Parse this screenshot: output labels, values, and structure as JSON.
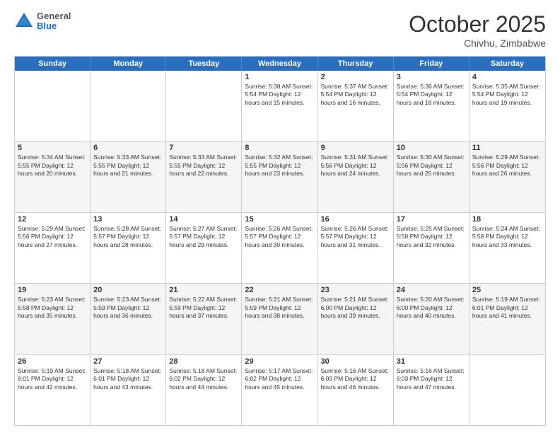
{
  "header": {
    "logo_general": "General",
    "logo_blue": "Blue",
    "month_title": "October 2025",
    "location": "Chivhu, Zimbabwe"
  },
  "days_of_week": [
    "Sunday",
    "Monday",
    "Tuesday",
    "Wednesday",
    "Thursday",
    "Friday",
    "Saturday"
  ],
  "rows": [
    {
      "cells": [
        {
          "day": "",
          "info": ""
        },
        {
          "day": "",
          "info": ""
        },
        {
          "day": "",
          "info": ""
        },
        {
          "day": "1",
          "info": "Sunrise: 5:38 AM\nSunset: 5:54 PM\nDaylight: 12 hours\nand 15 minutes."
        },
        {
          "day": "2",
          "info": "Sunrise: 5:37 AM\nSunset: 5:54 PM\nDaylight: 12 hours\nand 16 minutes."
        },
        {
          "day": "3",
          "info": "Sunrise: 5:36 AM\nSunset: 5:54 PM\nDaylight: 12 hours\nand 18 minutes."
        },
        {
          "day": "4",
          "info": "Sunrise: 5:35 AM\nSunset: 5:54 PM\nDaylight: 12 hours\nand 19 minutes."
        }
      ],
      "alt": false
    },
    {
      "cells": [
        {
          "day": "5",
          "info": "Sunrise: 5:34 AM\nSunset: 5:55 PM\nDaylight: 12 hours\nand 20 minutes."
        },
        {
          "day": "6",
          "info": "Sunrise: 5:33 AM\nSunset: 5:55 PM\nDaylight: 12 hours\nand 21 minutes."
        },
        {
          "day": "7",
          "info": "Sunrise: 5:33 AM\nSunset: 5:55 PM\nDaylight: 12 hours\nand 22 minutes."
        },
        {
          "day": "8",
          "info": "Sunrise: 5:32 AM\nSunset: 5:55 PM\nDaylight: 12 hours\nand 23 minutes."
        },
        {
          "day": "9",
          "info": "Sunrise: 5:31 AM\nSunset: 5:56 PM\nDaylight: 12 hours\nand 24 minutes."
        },
        {
          "day": "10",
          "info": "Sunrise: 5:30 AM\nSunset: 5:56 PM\nDaylight: 12 hours\nand 25 minutes."
        },
        {
          "day": "11",
          "info": "Sunrise: 5:29 AM\nSunset: 5:56 PM\nDaylight: 12 hours\nand 26 minutes."
        }
      ],
      "alt": true
    },
    {
      "cells": [
        {
          "day": "12",
          "info": "Sunrise: 5:29 AM\nSunset: 5:56 PM\nDaylight: 12 hours\nand 27 minutes."
        },
        {
          "day": "13",
          "info": "Sunrise: 5:28 AM\nSunset: 5:57 PM\nDaylight: 12 hours\nand 28 minutes."
        },
        {
          "day": "14",
          "info": "Sunrise: 5:27 AM\nSunset: 5:57 PM\nDaylight: 12 hours\nand 29 minutes."
        },
        {
          "day": "15",
          "info": "Sunrise: 5:26 AM\nSunset: 5:57 PM\nDaylight: 12 hours\nand 30 minutes."
        },
        {
          "day": "16",
          "info": "Sunrise: 5:26 AM\nSunset: 5:57 PM\nDaylight: 12 hours\nand 31 minutes."
        },
        {
          "day": "17",
          "info": "Sunrise: 5:25 AM\nSunset: 5:58 PM\nDaylight: 12 hours\nand 32 minutes."
        },
        {
          "day": "18",
          "info": "Sunrise: 5:24 AM\nSunset: 5:58 PM\nDaylight: 12 hours\nand 33 minutes."
        }
      ],
      "alt": false
    },
    {
      "cells": [
        {
          "day": "19",
          "info": "Sunrise: 5:23 AM\nSunset: 5:58 PM\nDaylight: 12 hours\nand 35 minutes."
        },
        {
          "day": "20",
          "info": "Sunrise: 5:23 AM\nSunset: 5:59 PM\nDaylight: 12 hours\nand 36 minutes."
        },
        {
          "day": "21",
          "info": "Sunrise: 5:22 AM\nSunset: 5:59 PM\nDaylight: 12 hours\nand 37 minutes."
        },
        {
          "day": "22",
          "info": "Sunrise: 5:21 AM\nSunset: 5:59 PM\nDaylight: 12 hours\nand 38 minutes."
        },
        {
          "day": "23",
          "info": "Sunrise: 5:21 AM\nSunset: 6:00 PM\nDaylight: 12 hours\nand 39 minutes."
        },
        {
          "day": "24",
          "info": "Sunrise: 5:20 AM\nSunset: 6:00 PM\nDaylight: 12 hours\nand 40 minutes."
        },
        {
          "day": "25",
          "info": "Sunrise: 5:19 AM\nSunset: 6:01 PM\nDaylight: 12 hours\nand 41 minutes."
        }
      ],
      "alt": true
    },
    {
      "cells": [
        {
          "day": "26",
          "info": "Sunrise: 5:19 AM\nSunset: 6:01 PM\nDaylight: 12 hours\nand 42 minutes."
        },
        {
          "day": "27",
          "info": "Sunrise: 5:18 AM\nSunset: 6:01 PM\nDaylight: 12 hours\nand 43 minutes."
        },
        {
          "day": "28",
          "info": "Sunrise: 5:18 AM\nSunset: 6:02 PM\nDaylight: 12 hours\nand 44 minutes."
        },
        {
          "day": "29",
          "info": "Sunrise: 5:17 AM\nSunset: 6:02 PM\nDaylight: 12 hours\nand 45 minutes."
        },
        {
          "day": "30",
          "info": "Sunrise: 5:16 AM\nSunset: 6:03 PM\nDaylight: 12 hours\nand 46 minutes."
        },
        {
          "day": "31",
          "info": "Sunrise: 5:16 AM\nSunset: 6:03 PM\nDaylight: 12 hours\nand 47 minutes."
        },
        {
          "day": "",
          "info": ""
        }
      ],
      "alt": false
    }
  ]
}
